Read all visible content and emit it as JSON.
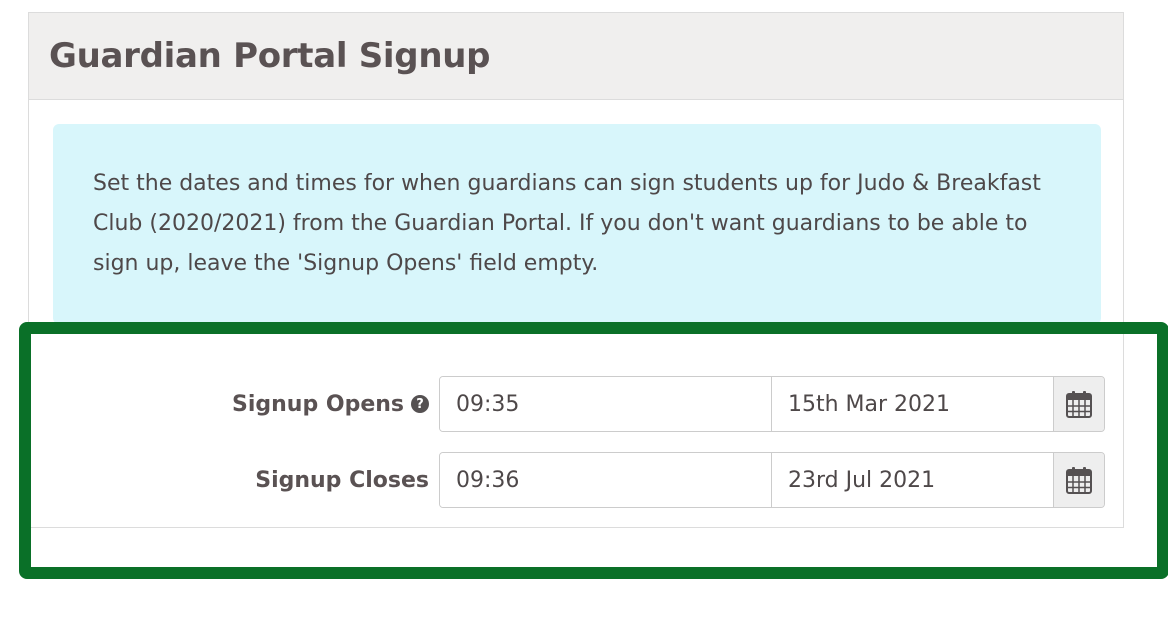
{
  "panel": {
    "title": "Guardian Portal Signup"
  },
  "info": {
    "text": "Set the dates and times for when guardians can sign students up for Judo & Breakfast Club (2020/2021) from the Guardian Portal. If you don't want guardians to be able to sign up, leave the 'Signup Opens' field empty."
  },
  "form": {
    "signup_opens": {
      "label": "Signup Opens",
      "help_icon": "question-circle-icon",
      "time": "09:35",
      "date": "15th Mar 2021",
      "calendar_icon": "calendar-icon"
    },
    "signup_closes": {
      "label": "Signup Closes",
      "time": "09:36",
      "date": "23rd Jul 2021",
      "calendar_icon": "calendar-icon"
    }
  },
  "colors": {
    "highlight": "#0a7028",
    "info_background": "#d8f6fb",
    "header_background": "#f0efee",
    "text": "#555152"
  }
}
